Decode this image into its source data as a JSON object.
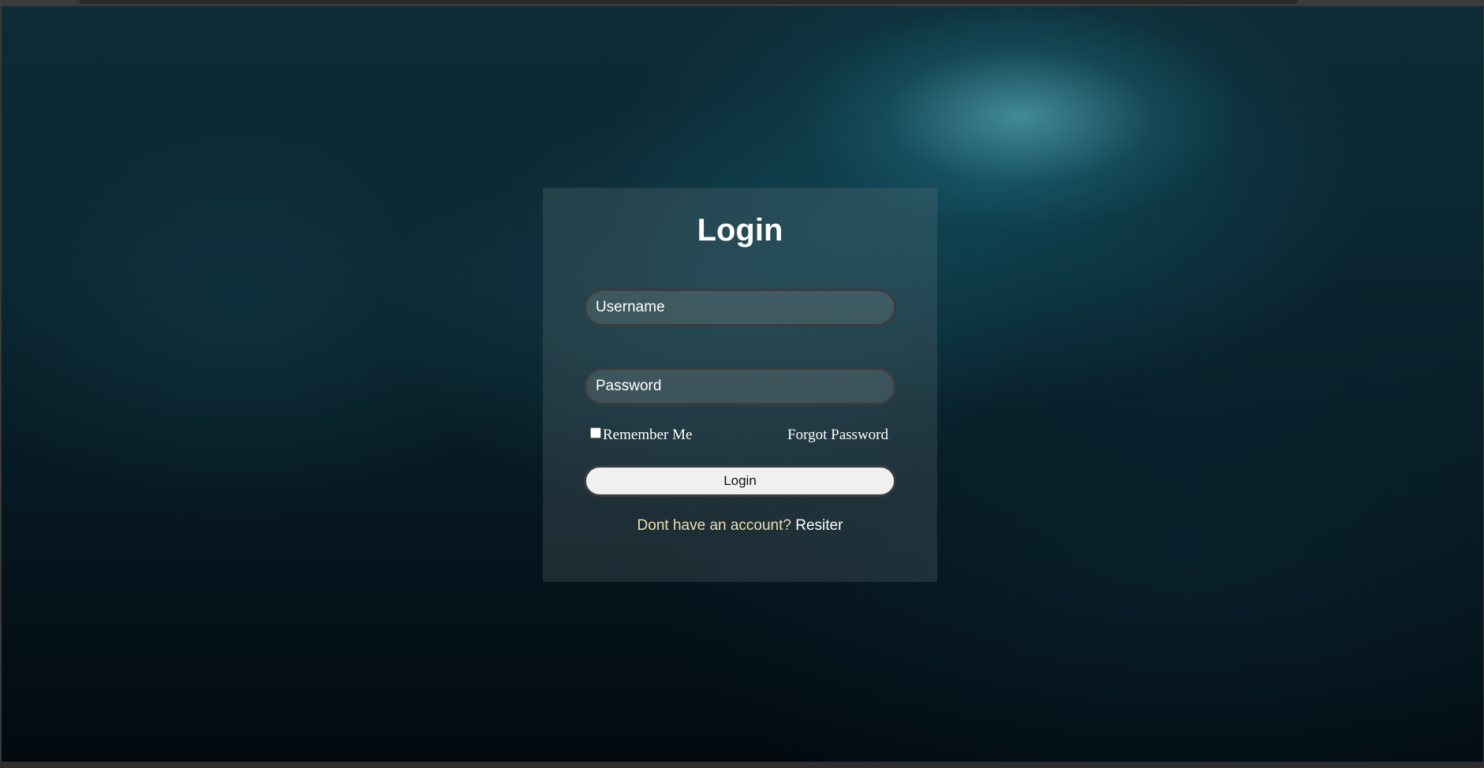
{
  "login": {
    "title": "Login",
    "username_placeholder": "Username",
    "password_placeholder": "Password",
    "remember_me_label": "Remember Me",
    "forgot_password_label": "Forgot Password",
    "login_button_label": "Login",
    "register_prompt": "Dont have an account?",
    "register_link_label": "Resiter"
  },
  "colors": {
    "register_prompt": "#f0deb2",
    "button_background": "#f0f0f0",
    "card_background": "rgba(120,130,135,0.22)"
  }
}
